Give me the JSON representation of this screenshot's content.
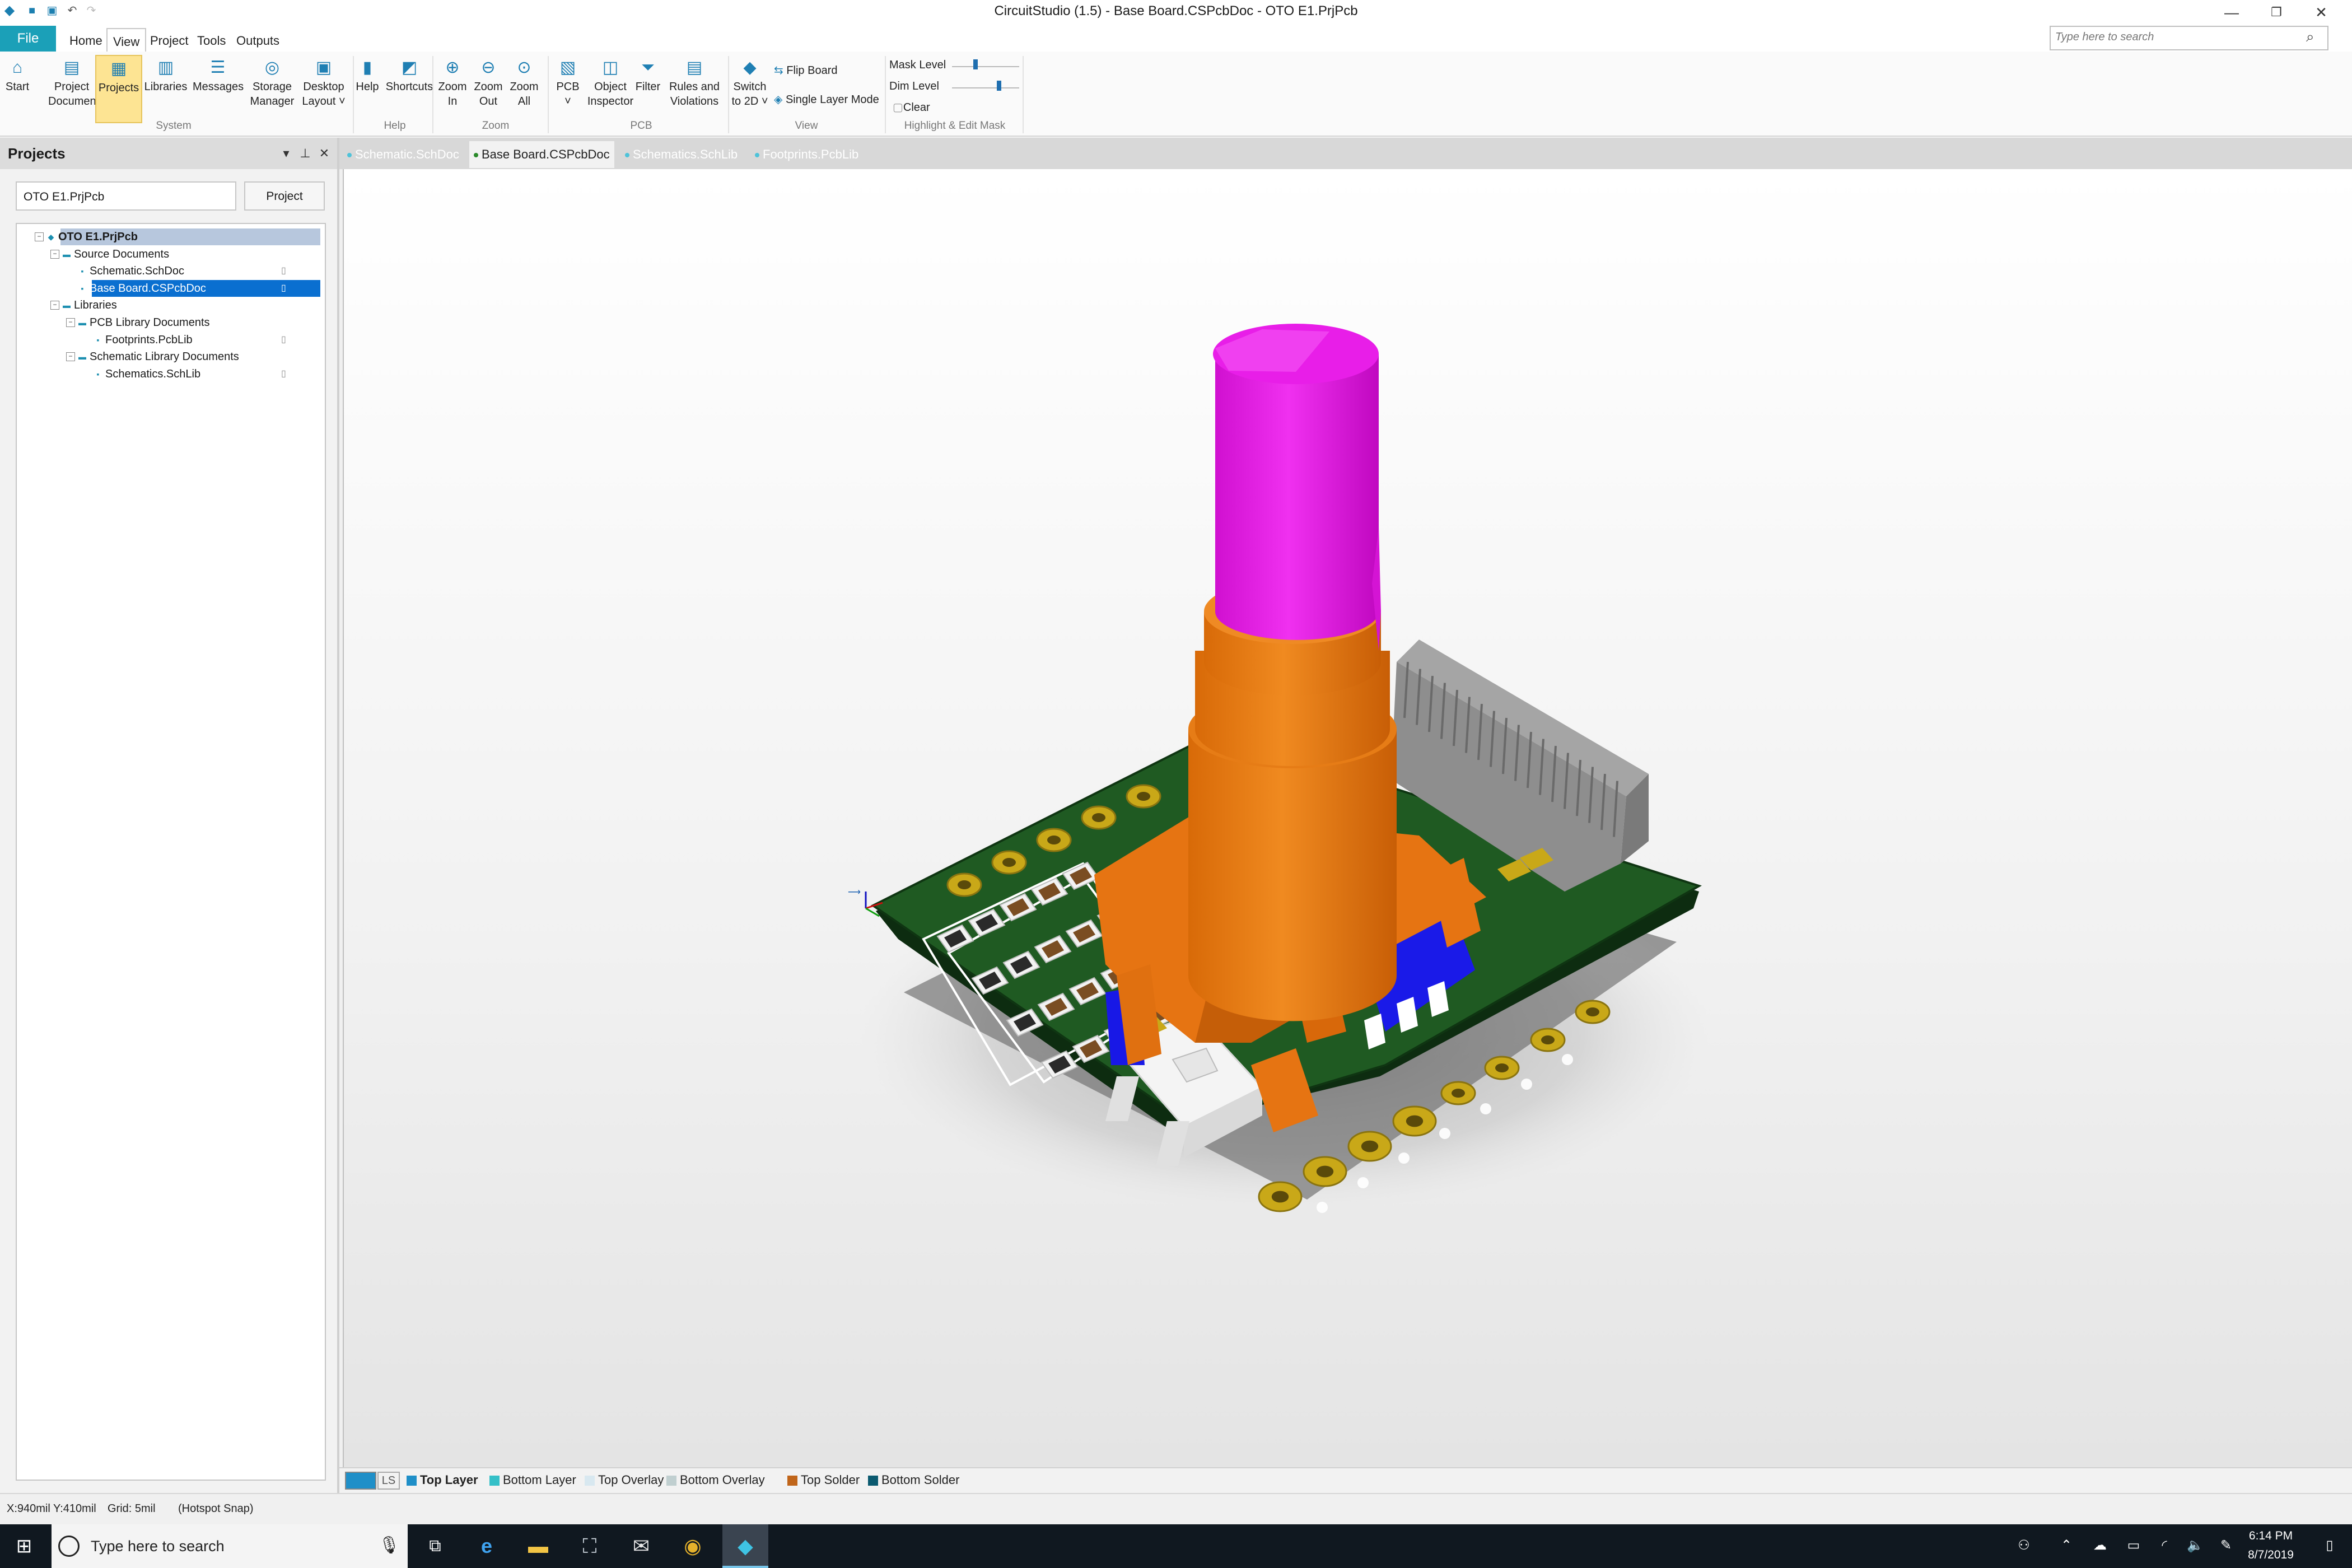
{
  "app": {
    "title": "CircuitStudio (1.5) - Base Board.CSPcbDoc - OTO E1.PrjPcb",
    "window_controls": {
      "minimize_icon": "minimize-icon",
      "restore_icon": "restore-icon",
      "close_icon": "close-icon"
    }
  },
  "menu": {
    "file": "File",
    "items": [
      "Home",
      "View",
      "Project",
      "Tools",
      "Outputs"
    ],
    "active": "View",
    "search_placeholder": "Type here to search"
  },
  "ribbon": {
    "buttons": [
      {
        "label1": "Start",
        "label2": "",
        "icon": "home-icon"
      },
      {
        "label1": "Project",
        "label2": "Documents",
        "icon": "project-documents-icon"
      },
      {
        "label1": "Projects",
        "label2": "",
        "icon": "projects-icon"
      },
      {
        "label1": "Libraries",
        "label2": "",
        "icon": "libraries-icon"
      },
      {
        "label1": "Messages",
        "label2": "",
        "icon": "messages-icon"
      },
      {
        "label1": "Storage",
        "label2": "Manager",
        "icon": "storage-manager-icon"
      },
      {
        "label1": "Desktop",
        "label2": "Layout ˅",
        "icon": "desktop-layout-icon"
      },
      {
        "label1": "Help",
        "label2": "",
        "icon": "help-icon"
      },
      {
        "label1": "Shortcuts",
        "label2": "",
        "icon": "shortcuts-icon"
      },
      {
        "label1": "Zoom",
        "label2": "In",
        "icon": "zoom-in-icon"
      },
      {
        "label1": "Zoom",
        "label2": "Out",
        "icon": "zoom-out-icon"
      },
      {
        "label1": "Zoom",
        "label2": "All",
        "icon": "zoom-all-icon"
      },
      {
        "label1": "PCB",
        "label2": "˅",
        "icon": "pcb-icon"
      },
      {
        "label1": "Object",
        "label2": "Inspector",
        "icon": "object-inspector-icon"
      },
      {
        "label1": "Filter",
        "label2": "",
        "icon": "filter-icon"
      },
      {
        "label1": "Rules and",
        "label2": "Violations",
        "icon": "rules-violations-icon"
      },
      {
        "label1": "Switch",
        "label2": "to 2D ˅",
        "icon": "switch-2d-icon"
      }
    ],
    "view_options": [
      "Flip Board",
      "Single Layer Mode"
    ],
    "mask": {
      "mask_level": "Mask Level",
      "dim_level": "Dim Level",
      "clear": "Clear",
      "mask_value": 0.35,
      "dim_value": 0.7
    },
    "groups": [
      "System",
      "Help",
      "Zoom",
      "PCB",
      "View",
      "Highlight & Edit Mask"
    ]
  },
  "panel": {
    "title": "Projects",
    "project_input": "OTO E1.PrjPcb",
    "project_button": "Project",
    "tree": [
      {
        "label": "OTO E1.PrjPcb",
        "level": 0,
        "expander": "⊟",
        "kind": "project"
      },
      {
        "label": "Source Documents",
        "level": 1,
        "expander": "⊟",
        "kind": "folder"
      },
      {
        "label": "Schematic.SchDoc",
        "level": 2,
        "expander": "",
        "kind": "file",
        "doc": true
      },
      {
        "label": "Base Board.CSPcbDoc",
        "level": 2,
        "expander": "",
        "kind": "file",
        "doc": true,
        "selected": true
      },
      {
        "label": "Libraries",
        "level": 1,
        "expander": "⊟",
        "kind": "folder"
      },
      {
        "label": "PCB Library Documents",
        "level": 2,
        "expander": "⊟",
        "kind": "folder"
      },
      {
        "label": "Footprints.PcbLib",
        "level": 3,
        "expander": "",
        "kind": "file",
        "doc": true
      },
      {
        "label": "Schematic Library Documents",
        "level": 2,
        "expander": "⊟",
        "kind": "folder"
      },
      {
        "label": "Schematics.SchLib",
        "level": 3,
        "expander": "",
        "kind": "file",
        "doc": true
      }
    ]
  },
  "doc_tabs": [
    {
      "label": "Schematic.SchDoc",
      "active": false
    },
    {
      "label": "Base Board.CSPcbDoc",
      "active": true
    },
    {
      "label": "Schematics.SchLib",
      "active": false
    },
    {
      "label": "Footprints.PcbLib",
      "active": false
    }
  ],
  "layers": {
    "ls": "LS",
    "items": [
      {
        "label": "Top Layer",
        "color": "#1f8fc8",
        "bold": true
      },
      {
        "label": "Bottom Layer",
        "color": "#35c0c8"
      },
      {
        "label": "Top Overlay",
        "color": "#d8e8f0"
      },
      {
        "label": "Bottom Overlay",
        "color": "#c0cfd0"
      },
      {
        "label": "Top Solder",
        "color": "#c0651a"
      },
      {
        "label": "Bottom Solder",
        "color": "#0b5a70"
      }
    ]
  },
  "status": {
    "coords": "X:940mil Y:410mil",
    "grid": "Grid: 5mil",
    "snap": "(Hotspot Snap)"
  },
  "taskbar": {
    "search": "Type here to search",
    "time": "6:14 PM",
    "date": "8/7/2019"
  },
  "colors": {
    "accent": "#1ba0b8",
    "pcb_green": "#1e5a22",
    "knob_orange": "#ec7a10",
    "shaft_magenta": "#e81ee8",
    "switch_blue": "#1e1ee6",
    "pad_gold": "#c9a818",
    "header_gray": "#9a9a9a",
    "selection": "#0a6fd0"
  }
}
